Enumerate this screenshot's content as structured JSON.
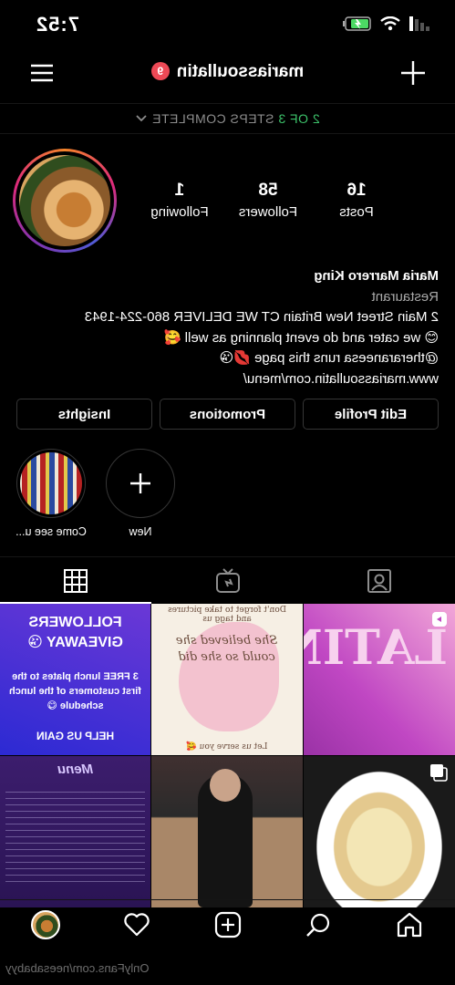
{
  "status": {
    "time": "7:52"
  },
  "header": {
    "username": "mariassoullatin",
    "notification_count": "9"
  },
  "steps": {
    "prefix": "",
    "done": "2 OF",
    "total": "3",
    "suffix": "STEPS COMPLETE"
  },
  "stats": [
    {
      "value": "16",
      "label": "Posts"
    },
    {
      "value": "58",
      "label": "Followers"
    },
    {
      "value": "1",
      "label": "Following"
    }
  ],
  "bio": {
    "name": "Maria Marrero King",
    "category": "Restaurant",
    "line1": "2 Main Street New Britain CT WE DELIVER 860-224-1943",
    "line2": "😊 we cater and do event planning as well 🥰",
    "line3": "@theraraneesa runs this page 💋😘",
    "website": "www.mariassoullatin.com/menu/"
  },
  "buttons": {
    "edit_profile": "Edit Profile",
    "promotions": "Promotions",
    "insights": "Insights"
  },
  "highlights": [
    {
      "label": "Come see u..."
    },
    {
      "label": "New"
    }
  ],
  "posts": {
    "post1_text": "LATIN",
    "post2_top": "Don't forget to take pictures and tagg us",
    "post2_quote": "She believed she could so she did",
    "post2_bottom": "Let us serve you 🥰",
    "post3_title": "FOLLOWERS GIVEAWAY 😘",
    "post3_body": "3 FREE lunch plates to the first customers of the lunch schedule 😋",
    "post3_foot": "HELP US GAIN",
    "post6_title": "Menu"
  },
  "watermark": "OnlyFans.com/neesababyy",
  "colors": {
    "accent_green": "#3cc26a",
    "badge_red": "#ed4956",
    "background": "#000000"
  }
}
